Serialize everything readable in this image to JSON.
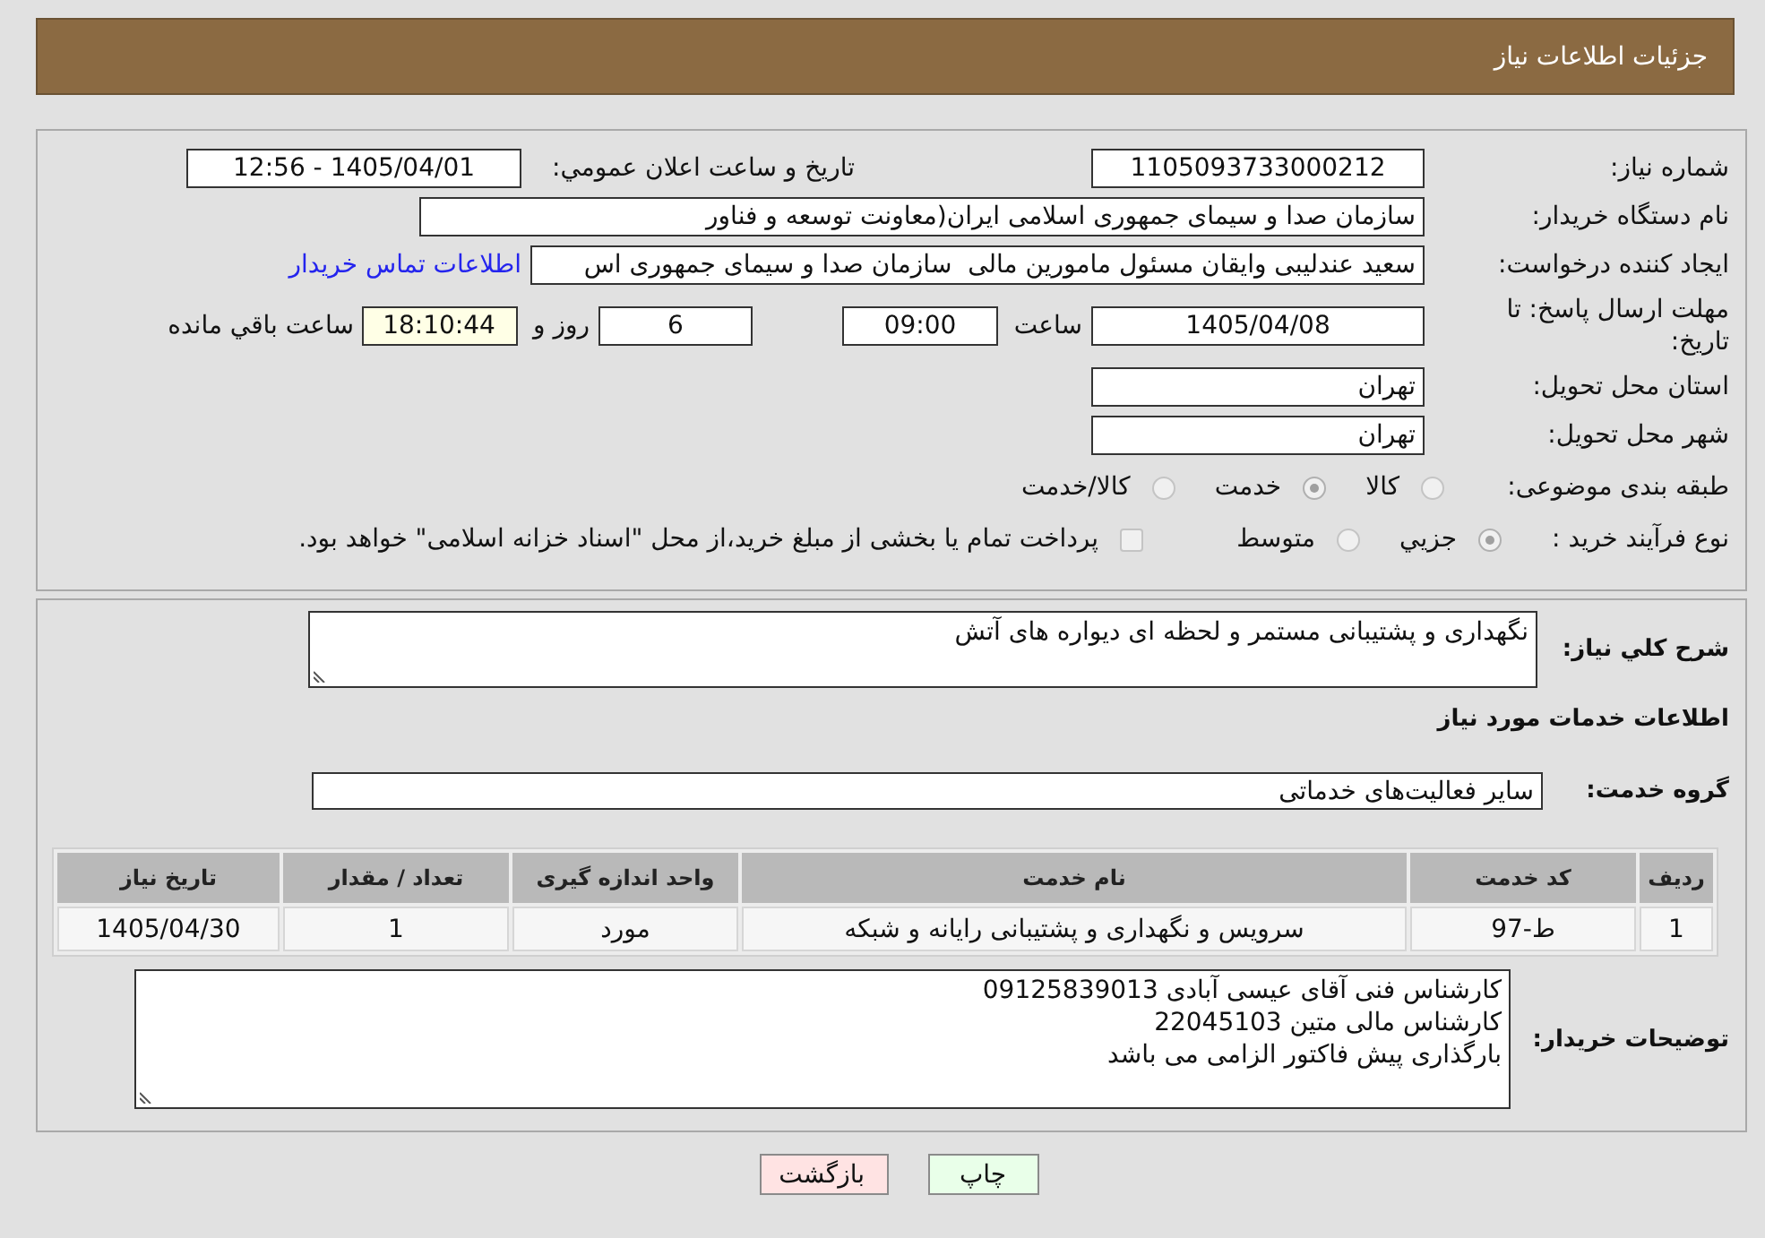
{
  "header": {
    "title": "جزئیات اطلاعات نیاز"
  },
  "details": {
    "need_number": {
      "label": "شماره نیاز:",
      "value": "1105093733000212"
    },
    "announce_datetime": {
      "label": "تاریخ و ساعت اعلان عمومي:",
      "value": "1405/04/01 - 12:56"
    },
    "buyer_org": {
      "label": "نام دستگاه خریدار:",
      "value": "سازمان صدا و سیمای جمهوری اسلامی ایران(معاونت توسعه و فناور"
    },
    "requester": {
      "label": "ایجاد کننده درخواست:",
      "value": "سعید عندلیبی وایقان مسئول مامورین مالی  سازمان صدا و سیمای جمهوری اس",
      "link": "اطلاعات تماس خریدار"
    },
    "deadline": {
      "label": "مهلت ارسال پاسخ: تا تاریخ:",
      "date": "1405/04/08",
      "time_label": "ساعت",
      "time": "09:00",
      "days": "6",
      "days_label": "روز و",
      "remaining": "18:10:44",
      "remaining_label": "ساعت باقي مانده"
    },
    "province": {
      "label": "استان محل تحویل:",
      "value": "تهران"
    },
    "city": {
      "label": "شهر محل تحویل:",
      "value": "تهران"
    },
    "category": {
      "label": "طبقه بندی موضوعی:",
      "options": [
        {
          "label": "کالا",
          "selected": false,
          "disabled": true
        },
        {
          "label": "خدمت",
          "selected": true,
          "disabled": true
        },
        {
          "label": "کالا/خدمت",
          "selected": false,
          "disabled": true
        }
      ]
    },
    "purchase_type": {
      "label": "نوع فرآیند خرید :",
      "options": [
        {
          "label": "جزيي",
          "selected": true,
          "disabled": true
        },
        {
          "label": "متوسط",
          "selected": false,
          "disabled": true
        }
      ],
      "treasury": {
        "label": "پرداخت تمام یا بخشی از مبلغ خرید،از محل \"اسناد خزانه اسلامی\" خواهد بود.",
        "checked": false,
        "disabled": true
      }
    }
  },
  "need_description": {
    "label": "شرح کلي نیاز:",
    "value": "نگهداری و پشتیبانی مستمر و لحظه ای دیواره های آتش"
  },
  "services": {
    "title": "اطلاعات خدمات مورد نیاز",
    "group_label": "گروه خدمت:",
    "group_value": "سایر فعالیت‌های خدماتی",
    "table": {
      "columns": [
        "ردیف",
        "کد خدمت",
        "نام خدمت",
        "واحد اندازه گیری",
        "تعداد / مقدار",
        "تاریخ نیاز"
      ],
      "rows": [
        [
          "1",
          "ط-97",
          "سرویس و نگهداری و پشتیبانی رایانه و شبکه",
          "مورد",
          "1",
          "1405/04/30"
        ]
      ]
    }
  },
  "buyer_notes": {
    "label": "توضیحات خریدار:",
    "value": "کارشناس فنی آقای عیسی آبادی 09125839013\nکارشناس مالی متین 22045103\nبارگذاری پیش فاکتور الزامی می باشد"
  },
  "buttons": [
    {
      "label": "چاپ",
      "kind": "print"
    },
    {
      "label": "بازگشت",
      "kind": "back"
    }
  ]
}
